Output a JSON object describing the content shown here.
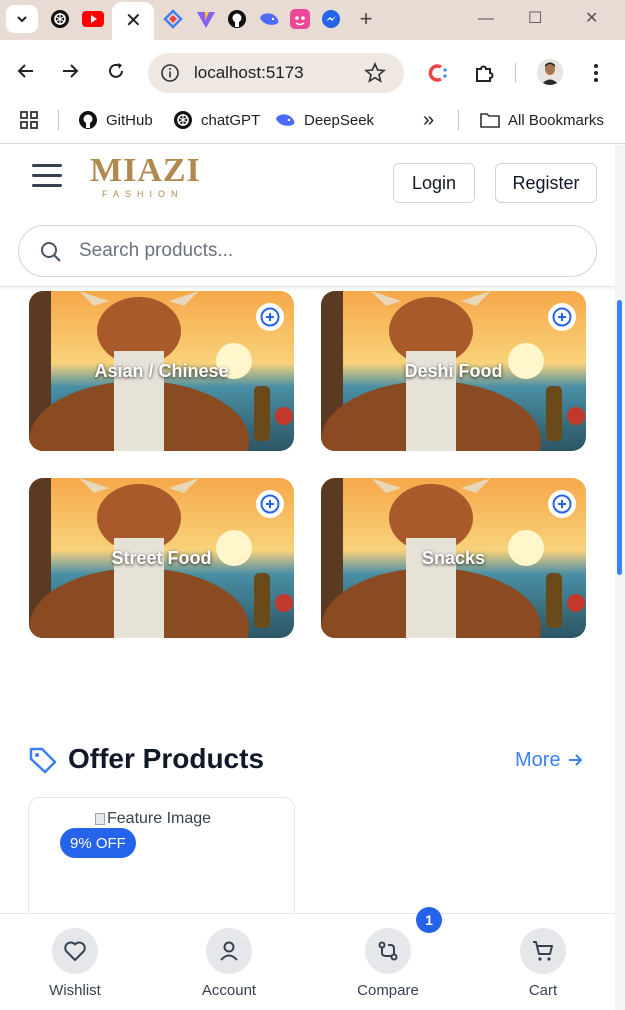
{
  "browser": {
    "tabs": [
      {
        "name": "chatgpt-tab",
        "icon": "openai-icon"
      },
      {
        "name": "youtube-tab",
        "icon": "youtube-icon"
      },
      {
        "name": "active-tab",
        "icon": "close-icon"
      },
      {
        "name": "devtools-tab",
        "icon": "diamond-icon"
      },
      {
        "name": "vite-tab",
        "icon": "vite-icon"
      },
      {
        "name": "github-tab",
        "icon": "github-icon"
      },
      {
        "name": "deepseek-tab",
        "icon": "whale-icon"
      },
      {
        "name": "app-tab",
        "icon": "pink-app-icon"
      },
      {
        "name": "messenger-tab",
        "icon": "messenger-icon"
      }
    ],
    "new_tab_label": "+",
    "url": "localhost:5173",
    "bookmarks": [
      {
        "label": "GitHub",
        "icon": "github-icon"
      },
      {
        "label": "chatGPT",
        "icon": "openai-icon"
      },
      {
        "label": "DeepSeek",
        "icon": "whale-icon"
      }
    ],
    "overflow_label": "»",
    "all_bookmarks_label": "All Bookmarks"
  },
  "header": {
    "logo_main": "MIAZI",
    "logo_sub": "FASHION",
    "login_label": "Login",
    "register_label": "Register"
  },
  "search": {
    "placeholder": "Search products..."
  },
  "categories": [
    {
      "label": "Asian / Chinese"
    },
    {
      "label": "Deshi Food"
    },
    {
      "label": "Street Food"
    },
    {
      "label": "Snacks"
    }
  ],
  "offers": {
    "title": "Offer Products",
    "more_label": "More",
    "product": {
      "image_alt": "Feature Image",
      "discount": "9% OFF"
    }
  },
  "bottom_nav": {
    "wishlist": "Wishlist",
    "account": "Account",
    "compare": "Compare",
    "compare_count": "1",
    "cart": "Cart"
  },
  "colors": {
    "accent": "#3b82f6",
    "badge": "#2563eb",
    "logo_gold": "#b08850"
  }
}
